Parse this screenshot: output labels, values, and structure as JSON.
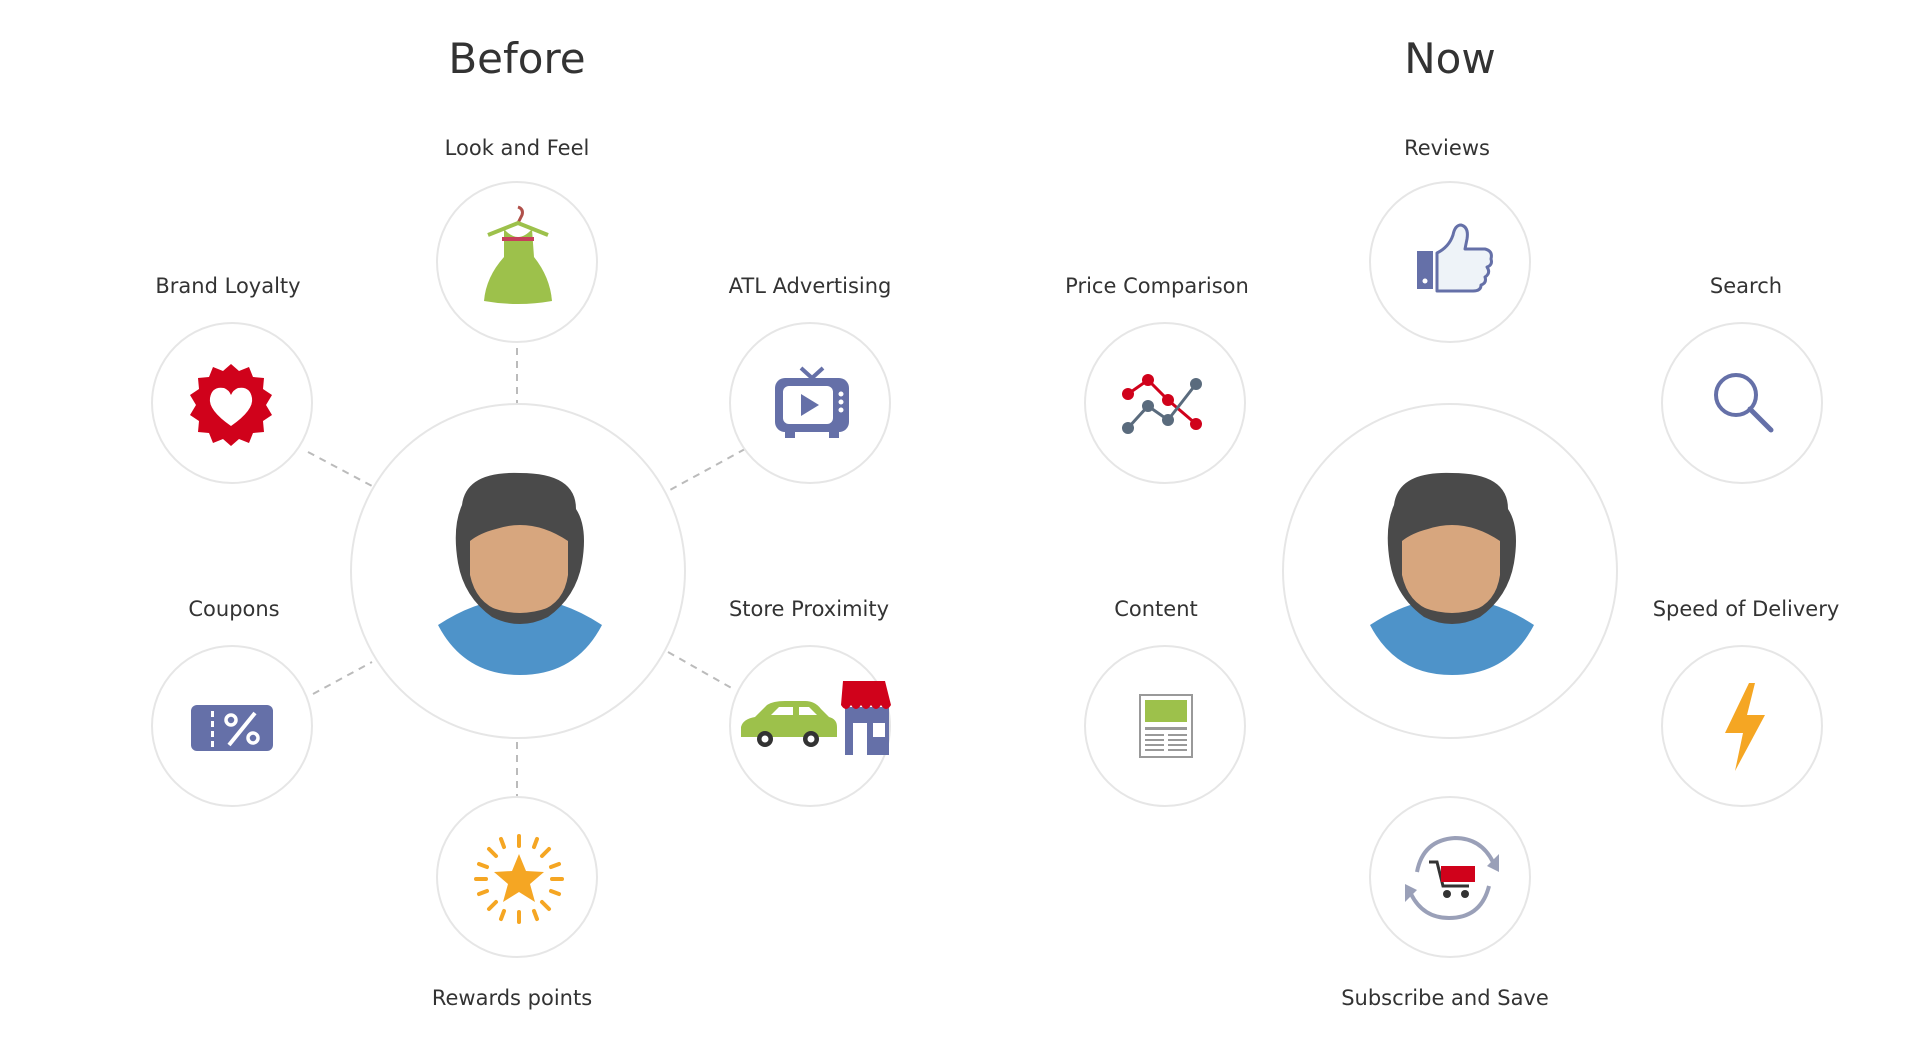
{
  "before": {
    "title": "Before",
    "look_and_feel": "Look and Feel",
    "brand_loyalty": "Brand Loyalty",
    "atl_advertising": "ATL Advertising",
    "coupons": "Coupons",
    "store_proximity": "Store Proximity",
    "rewards_points": "Rewards points"
  },
  "now": {
    "title": "Now",
    "reviews": "Reviews",
    "price_comparison": "Price Comparison",
    "search": "Search",
    "content": "Content",
    "speed_of_delivery": "Speed of Delivery",
    "subscribe_and_save": "Subscribe and Save"
  },
  "colors": {
    "circle_border": "#e6e6e6",
    "connector": "#bbbbbb",
    "hair": "#4a4a4a",
    "skin": "#d7a67e",
    "shirt": "#4e93c9",
    "green": "#9dc14b",
    "red": "#d0021b",
    "slate_blue": "#6570a8",
    "orange": "#f5a623"
  },
  "icons": [
    "dress-icon",
    "heart-badge-icon",
    "tv-icon",
    "coupon-icon",
    "car-store-icon",
    "star-burst-icon",
    "thumbs-up-icon",
    "price-chart-icon",
    "search-icon",
    "newspaper-icon",
    "lightning-icon",
    "cart-cycle-icon",
    "person-avatar-icon"
  ]
}
